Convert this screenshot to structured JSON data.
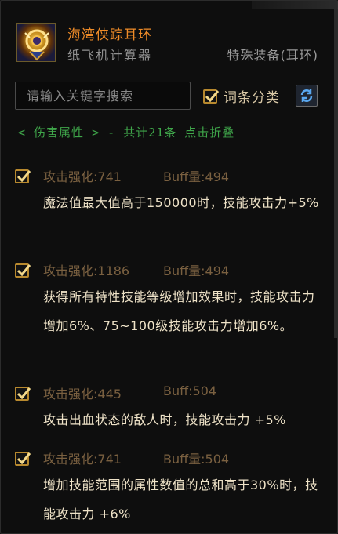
{
  "header": {
    "item_name": "海湾侠踪耳环",
    "source": "纸飞机计算器",
    "item_type": "特殊装备(耳环)",
    "icon": "earring-item-icon"
  },
  "search": {
    "placeholder": "请输入关键字搜索",
    "value": "",
    "classify_label": "词条分类",
    "classify_checked": true,
    "refresh_icon": "refresh-icon"
  },
  "group": {
    "header_text": "< 伤害属性 > - 共计21条 点击折叠"
  },
  "entries": [
    {
      "stat": "攻击强化:741",
      "buff": "Buff量:494",
      "description": "魔法值最大值高于150000时，技能攻击力+5%"
    },
    {
      "stat": "攻击强化:1186",
      "buff": "Buff量:494",
      "description": "获得所有特性技能等级增加效果时，技能攻击力增加6%、75~100级技能攻击力增加6%。"
    },
    {
      "stat": "攻击强化:445",
      "buff": "Buff:504",
      "description": "攻击出血状态的敌人时，技能攻击力 +5%"
    },
    {
      "stat": "攻击强化:741",
      "buff": "Buff量:504",
      "description": "增加技能范围的属性数值的总和高于30%时，技能攻击力 +6%"
    }
  ],
  "colors": {
    "accent_orange": "#f08c28",
    "checkbox_gold": "#b8892e",
    "group_green": "#3fa64a",
    "stat_brown": "#7a6040"
  }
}
